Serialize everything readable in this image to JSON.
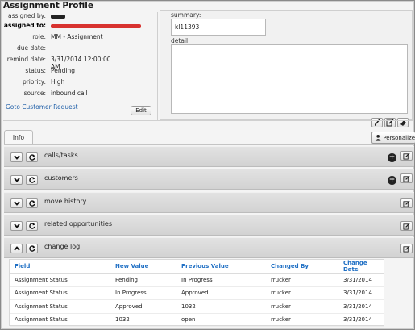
{
  "title": "Assignment Profile",
  "fields": {
    "assigned_by_label": "assigned by:",
    "assigned_to_label": "assigned to:",
    "role_label": "role:",
    "role_value": "MM - Assignment",
    "due_date_label": "due date:",
    "due_date_value": "",
    "remind_date_label": "remind date:",
    "remind_date_value": "3/31/2014 12:00:00 AM",
    "status_label": "status:",
    "status_value": "Pending",
    "priority_label": "priority:",
    "priority_value": "High",
    "source_label": "source:",
    "source_value": "inbound call"
  },
  "goto_link": "Goto Customer Request",
  "edit_button": "Edit",
  "summary_label": "summary:",
  "summary_value": "kl11393",
  "detail_label": "detail:",
  "tabs": [
    {
      "label": "Info"
    }
  ],
  "personalize_label": "Personalize",
  "sections": [
    {
      "label": "calls/tasks"
    },
    {
      "label": "customers"
    },
    {
      "label": "move history"
    },
    {
      "label": "related opportunities"
    },
    {
      "label": "change log"
    }
  ],
  "change_log": {
    "columns": [
      "Field",
      "New Value",
      "Previous Value",
      "Changed By",
      "Change Date"
    ],
    "rows": [
      [
        "Assignment Status",
        "Pending",
        "In Progress",
        "rrucker",
        "3/31/2014"
      ],
      [
        "Assignment Status",
        "In Progress",
        "Approved",
        "rrucker",
        "3/31/2014"
      ],
      [
        "Assignment Status",
        "Approved",
        "1032",
        "rrucker",
        "3/31/2014"
      ],
      [
        "Assignment Status",
        "1032",
        "open",
        "rrucker",
        "3/31/2014"
      ]
    ]
  },
  "icons": {
    "expand": "chevron-down-icon",
    "collapse": "chevron-up-icon",
    "refresh": "refresh-icon",
    "add": "plus-circle-icon",
    "edit": "edit-icon",
    "brush": "brush-icon",
    "eraser": "eraser-icon",
    "user": "user-icon"
  },
  "colors": {
    "link": "#1f5fa8",
    "table_header": "#1f6fc4",
    "redact_red": "#d8322f"
  }
}
